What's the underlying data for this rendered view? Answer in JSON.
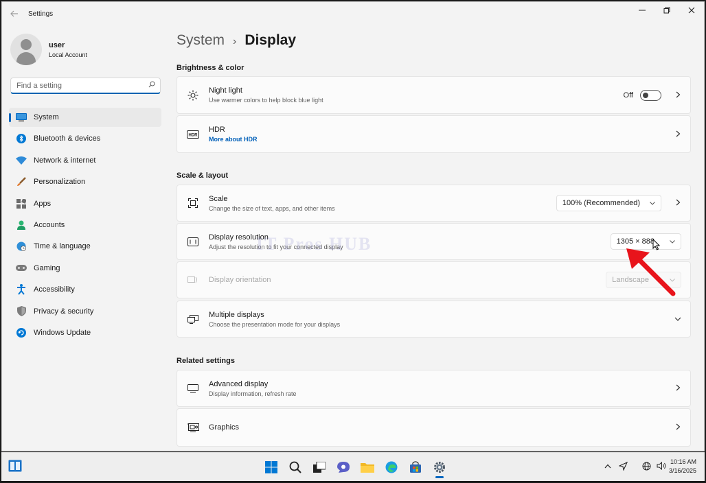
{
  "window": {
    "title": "Settings",
    "back_icon": "back-arrow-icon",
    "controls": [
      "minimize-icon",
      "restore-icon",
      "close-icon"
    ]
  },
  "profile": {
    "name": "user",
    "account_type": "Local Account"
  },
  "search": {
    "placeholder": "Find a setting"
  },
  "sidebar": {
    "items": [
      {
        "label": "System",
        "icon": "monitor-icon",
        "active": true
      },
      {
        "label": "Bluetooth & devices",
        "icon": "bluetooth-icon"
      },
      {
        "label": "Network & internet",
        "icon": "wifi-icon"
      },
      {
        "label": "Personalization",
        "icon": "brush-icon"
      },
      {
        "label": "Apps",
        "icon": "apps-icon"
      },
      {
        "label": "Accounts",
        "icon": "person-icon"
      },
      {
        "label": "Time & language",
        "icon": "globe-clock-icon"
      },
      {
        "label": "Gaming",
        "icon": "gamepad-icon"
      },
      {
        "label": "Accessibility",
        "icon": "accessibility-icon"
      },
      {
        "label": "Privacy & security",
        "icon": "shield-icon"
      },
      {
        "label": "Windows Update",
        "icon": "update-icon"
      }
    ]
  },
  "breadcrumb": {
    "parent": "System",
    "separator": "›",
    "current": "Display"
  },
  "sections": {
    "brightness": "Brightness & color",
    "scale_layout": "Scale & layout",
    "related": "Related settings"
  },
  "cards": {
    "night_light": {
      "title": "Night light",
      "subtitle": "Use warmer colors to help block blue light",
      "toggle_label": "Off"
    },
    "hdr": {
      "title": "HDR",
      "link": "More about HDR",
      "icon_text": "HDR"
    },
    "scale": {
      "title": "Scale",
      "subtitle": "Change the size of text, apps, and other items",
      "value": "100% (Recommended)"
    },
    "resolution": {
      "title": "Display resolution",
      "subtitle": "Adjust the resolution to fit your connected display",
      "value": "1305 × 888"
    },
    "orientation": {
      "title": "Display orientation",
      "value": "Landscape"
    },
    "multiple": {
      "title": "Multiple displays",
      "subtitle": "Choose the presentation mode for your displays"
    },
    "advanced": {
      "title": "Advanced display",
      "subtitle": "Display information, refresh rate"
    },
    "graphics": {
      "title": "Graphics"
    }
  },
  "watermark": "IT Pros HUB",
  "taskbar": {
    "apps": [
      "windows-start-icon",
      "search-icon",
      "task-view-icon",
      "chat-icon",
      "file-explorer-icon",
      "edge-icon",
      "store-icon",
      "settings-gear-icon"
    ],
    "tray": [
      "chevron-up-icon",
      "location-icon",
      "network-icon",
      "volume-icon"
    ],
    "time": "10:16 AM",
    "date": "3/16/2025"
  },
  "colors": {
    "accent": "#0067c0",
    "annotation_arrow": "#e8141b"
  }
}
